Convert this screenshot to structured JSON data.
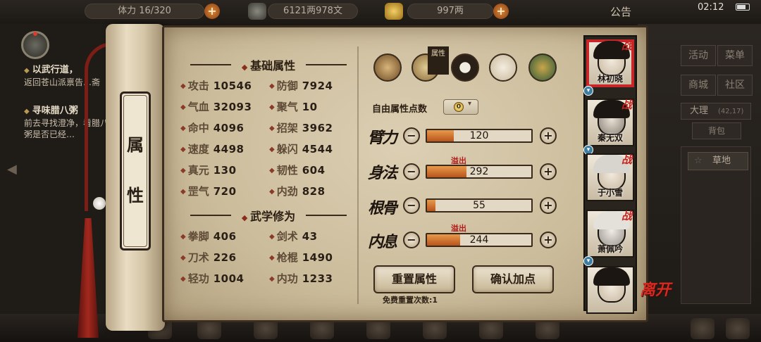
{
  "topbar": {
    "stamina": "体力 16/320",
    "money": "6121两978文",
    "gold": "997两",
    "notice": "公告",
    "time": "02:12"
  },
  "quests": [
    {
      "title": "以武行道，",
      "desc": "返回苍山派禀告…斋"
    },
    {
      "title": "寻味腊八粥",
      "desc": "前去寻找澄净，看腊八粥是否已经…"
    }
  ],
  "right_menu": {
    "activity": "活动",
    "menu": "菜单",
    "shop": "商城",
    "community": "社区",
    "location": "大理",
    "coords": "(42,17)",
    "bag": "背包",
    "terrain": "草地"
  },
  "scroll": {
    "title_1": "属",
    "title_2": "性"
  },
  "basic": {
    "title": "基础属性",
    "stats": [
      {
        "label": "攻击",
        "value": "10546"
      },
      {
        "label": "防御",
        "value": "7924"
      },
      {
        "label": "气血",
        "value": "32093"
      },
      {
        "label": "聚气",
        "value": "10"
      },
      {
        "label": "命中",
        "value": "4096"
      },
      {
        "label": "招架",
        "value": "3962"
      },
      {
        "label": "速度",
        "value": "4498"
      },
      {
        "label": "躲闪",
        "value": "4544"
      },
      {
        "label": "真元",
        "value": "130"
      },
      {
        "label": "韧性",
        "value": "604"
      },
      {
        "label": "罡气",
        "value": "720"
      },
      {
        "label": "内劲",
        "value": "828"
      }
    ]
  },
  "martial": {
    "title": "武学修为",
    "stats": [
      {
        "label": "拳脚",
        "value": "406"
      },
      {
        "label": "剑术",
        "value": "43"
      },
      {
        "label": "刀术",
        "value": "226"
      },
      {
        "label": "枪棍",
        "value": "1490"
      },
      {
        "label": "轻功",
        "value": "1004"
      },
      {
        "label": "内功",
        "value": "1233"
      }
    ]
  },
  "tabs": {
    "selected_label": "属性",
    "icons": [
      "straw-hat-icon",
      "scroll-pouch-icon",
      "yin-yang-icon",
      "body-pose-icon",
      "compass-disc-icon"
    ]
  },
  "free_points": {
    "label": "自由属性点数",
    "value": "0"
  },
  "attributes": [
    {
      "name": "臂力",
      "value": "120",
      "fill": 0.26,
      "overflow": ""
    },
    {
      "name": "身法",
      "value": "292",
      "fill": 0.38,
      "overflow": "溢出"
    },
    {
      "name": "根骨",
      "value": "55",
      "fill": 0.08,
      "overflow": ""
    },
    {
      "name": "内息",
      "value": "244",
      "fill": 0.32,
      "overflow": "溢出"
    }
  ],
  "buttons": {
    "reset": "重置属性",
    "confirm": "确认加点",
    "free_reset": "免费重置次数:1"
  },
  "roster": [
    {
      "name": "林初晓",
      "tag": "战",
      "selected": true
    },
    {
      "name": "秦无双",
      "tag": "战",
      "selected": false
    },
    {
      "name": "于小雪",
      "tag": "战",
      "selected": false
    },
    {
      "name": "萧佩吟",
      "tag": "战",
      "selected": false
    },
    {
      "name": "",
      "tag": "",
      "selected": false
    }
  ],
  "leave_label": "离开",
  "colors": {
    "accent_red": "#c8231e",
    "bar_fill": "#d0742e",
    "paper": "#cbbc9b"
  }
}
